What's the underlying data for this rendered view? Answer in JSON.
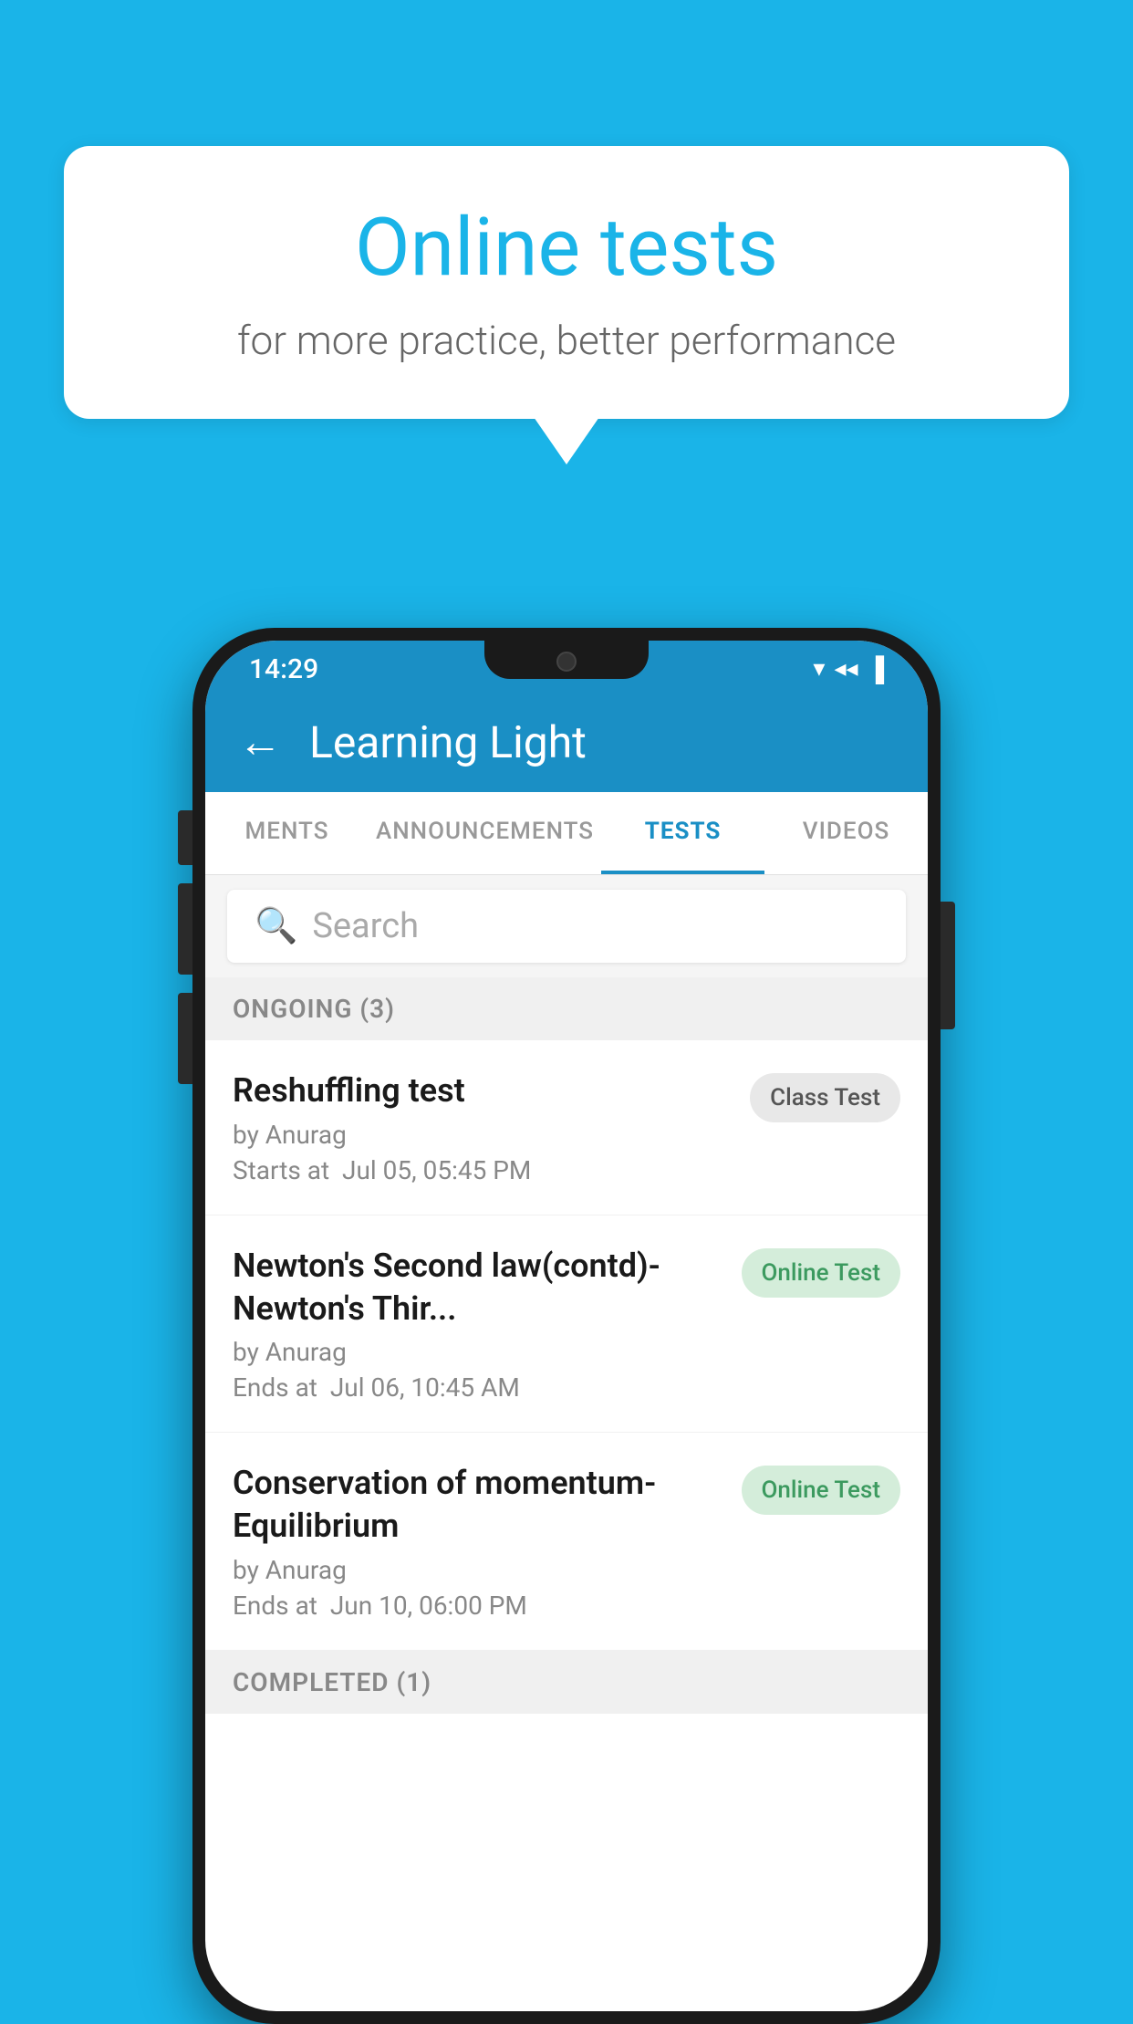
{
  "background": {
    "color": "#1ab4e8"
  },
  "speech_bubble": {
    "title": "Online tests",
    "subtitle": "for more practice, better performance"
  },
  "phone": {
    "status_bar": {
      "time": "14:29",
      "wifi_icon": "▾",
      "signal_icon": "◂",
      "battery_icon": "▌"
    },
    "app_bar": {
      "back_icon": "←",
      "title": "Learning Light"
    },
    "tabs": [
      {
        "label": "MENTS",
        "active": false
      },
      {
        "label": "ANNOUNCEMENTS",
        "active": false
      },
      {
        "label": "TESTS",
        "active": true
      },
      {
        "label": "VIDEOS",
        "active": false
      }
    ],
    "search": {
      "placeholder": "Search",
      "icon": "🔍"
    },
    "ongoing_section": {
      "label": "ONGOING (3)"
    },
    "tests": [
      {
        "name": "Reshuffling test",
        "author": "by Anurag",
        "time_label": "Starts at",
        "time": "Jul 05, 05:45 PM",
        "badge": "Class Test",
        "badge_type": "class"
      },
      {
        "name": "Newton's Second law(contd)-Newton's Thir...",
        "author": "by Anurag",
        "time_label": "Ends at",
        "time": "Jul 06, 10:45 AM",
        "badge": "Online Test",
        "badge_type": "online"
      },
      {
        "name": "Conservation of momentum-Equilibrium",
        "author": "by Anurag",
        "time_label": "Ends at",
        "time": "Jun 10, 06:00 PM",
        "badge": "Online Test",
        "badge_type": "online"
      }
    ],
    "completed_section": {
      "label": "COMPLETED (1)"
    }
  }
}
